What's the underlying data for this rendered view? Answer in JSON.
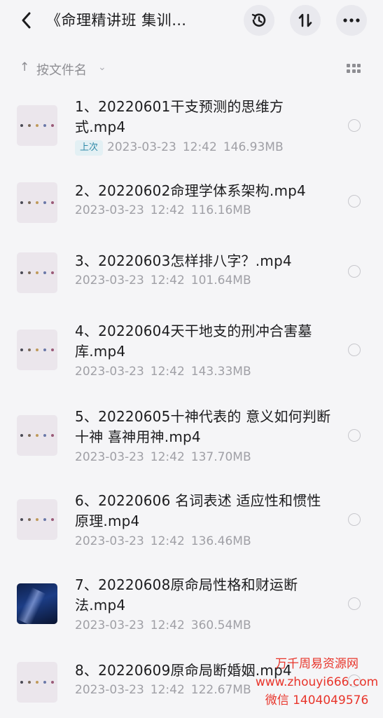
{
  "header": {
    "title": "《命理精讲班 集训…"
  },
  "sort": {
    "label": "按文件名",
    "arrow": "↑",
    "chevron": "⌄"
  },
  "files": [
    {
      "name": "1、20220601干支预测的思维方式.mp4",
      "badge": "上次",
      "date": "2023-03-23",
      "time": "12:42",
      "size": "146.93MB",
      "thumb": "video-frame"
    },
    {
      "name": "2、20220602命理学体系架构.mp4",
      "date": "2023-03-23",
      "time": "12:42",
      "size": "116.16MB",
      "thumb": "video-frame"
    },
    {
      "name": "3、20220603怎样排八字？.mp4",
      "date": "2023-03-23",
      "time": "12:42",
      "size": "101.64MB",
      "thumb": "video-frame"
    },
    {
      "name": "4、20220604天干地支的刑冲合害墓库.mp4",
      "date": "2023-03-23",
      "time": "12:42",
      "size": "143.33MB",
      "thumb": "video-frame"
    },
    {
      "name": "5、20220605十神代表的  意义如何判断十神 喜神用神.mp4",
      "date": "2023-03-23",
      "time": "12:42",
      "size": "137.70MB",
      "thumb": "video-frame"
    },
    {
      "name": "6、20220606 名词表述 适应性和惯性原理.mp4",
      "date": "2023-03-23",
      "time": "12:42",
      "size": "136.46MB",
      "thumb": "video-frame"
    },
    {
      "name": "7、20220608原命局性格和财运断法.mp4",
      "date": "2023-03-23",
      "time": "12:42",
      "size": "360.54MB",
      "thumb": "starry-sky"
    },
    {
      "name": "8、20220609原命局断婚姻.mp4",
      "date": "2023-03-23",
      "time": "12:42",
      "size": "122.67MB",
      "thumb": "video-frame"
    }
  ],
  "watermark": {
    "line1": "万千周易资源网",
    "line2": "www.zhouyi666.com",
    "line3": "微信 1404049576"
  },
  "colors": {
    "background": "#f5f5f7",
    "badge_text": "#2f8aa8",
    "badge_bg": "#e3f0f4",
    "watermark": "#e8352b"
  }
}
